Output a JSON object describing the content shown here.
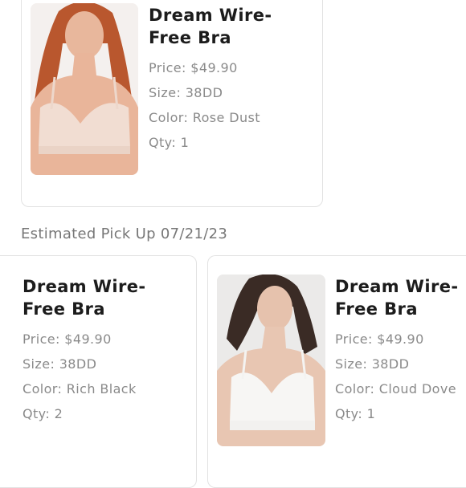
{
  "orders": [
    {
      "name": "Dream Wire-Free Bra",
      "price": "Price: $49.90",
      "size": "Size: 38DD",
      "color": "Color: Rose Dust",
      "qty": "Qty: 1"
    }
  ],
  "pickup": {
    "label": "Estimated Pick Up 07/21/23",
    "items": [
      {
        "name": "Dream Wire-Free Bra",
        "price": "Price: $49.90",
        "size": "Size: 38DD",
        "color": "Color: Rich Black",
        "qty": "Qty: 2"
      },
      {
        "name": "Dream Wire-Free Bra",
        "price": "Price: $49.90",
        "size": "Size: 38DD",
        "color": "Color: Cloud Dove",
        "qty": "Qty: 1"
      }
    ]
  },
  "colors": {
    "card_border": "#e2e2e2",
    "title_text": "#1c1c1c",
    "attr_text": "#8a8a8a",
    "section_text": "#777777"
  }
}
